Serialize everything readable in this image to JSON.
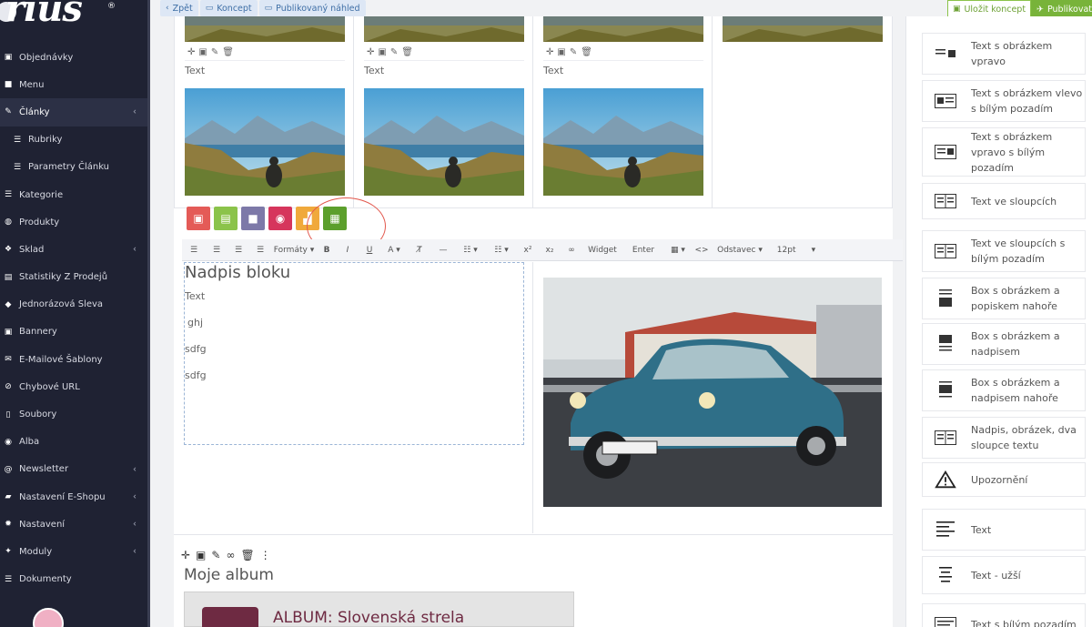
{
  "sidebar": {
    "logo_text": "rius",
    "items": [
      {
        "label": "Objednávky",
        "icon": "cart-icon",
        "chevron": false,
        "active": false,
        "sub": false
      },
      {
        "label": "Menu",
        "icon": "folder-icon",
        "chevron": false,
        "active": false,
        "sub": false
      },
      {
        "label": "Články",
        "icon": "pencil-icon",
        "chevron": true,
        "active": true,
        "sub": false
      },
      {
        "label": "Rubriky",
        "icon": "list-icon",
        "chevron": false,
        "active": false,
        "sub": true
      },
      {
        "label": "Parametry Článku",
        "icon": "sliders-icon",
        "chevron": false,
        "active": false,
        "sub": true
      },
      {
        "label": "Kategorie",
        "icon": "list-icon",
        "chevron": false,
        "active": false,
        "sub": false
      },
      {
        "label": "Produkty",
        "icon": "globe-icon",
        "chevron": false,
        "active": false,
        "sub": false
      },
      {
        "label": "Sklad",
        "icon": "boxes-icon",
        "chevron": true,
        "active": false,
        "sub": false
      },
      {
        "label": "Statistiky Z Prodejů",
        "icon": "chart-icon",
        "chevron": false,
        "active": false,
        "sub": false
      },
      {
        "label": "Jednorázová Sleva",
        "icon": "tag-icon",
        "chevron": false,
        "active": false,
        "sub": false
      },
      {
        "label": "Bannery",
        "icon": "image-icon",
        "chevron": false,
        "active": false,
        "sub": false
      },
      {
        "label": "E-Mailové Šablony",
        "icon": "envelope-icon",
        "chevron": false,
        "active": false,
        "sub": false
      },
      {
        "label": "Chybové URL",
        "icon": "unlink-icon",
        "chevron": false,
        "active": false,
        "sub": false
      },
      {
        "label": "Soubory",
        "icon": "file-icon",
        "chevron": false,
        "active": false,
        "sub": false
      },
      {
        "label": "Alba",
        "icon": "camera-icon",
        "chevron": false,
        "active": false,
        "sub": false
      },
      {
        "label": "Newsletter",
        "icon": "at-icon",
        "chevron": true,
        "active": false,
        "sub": false
      },
      {
        "label": "Nastavení E-Shopu",
        "icon": "truck-icon",
        "chevron": true,
        "active": false,
        "sub": false
      },
      {
        "label": "Nastavení",
        "icon": "gear-icon",
        "chevron": true,
        "active": false,
        "sub": false
      },
      {
        "label": "Moduly",
        "icon": "puzzle-icon",
        "chevron": true,
        "active": false,
        "sub": false
      },
      {
        "label": "Dokumenty",
        "icon": "list-icon",
        "chevron": false,
        "active": false,
        "sub": false
      }
    ]
  },
  "topbar": {
    "back": "Zpět",
    "draft": "Koncept",
    "preview": "Publikovaný náhled",
    "save_draft": "Uložit koncept",
    "publish": "Publikovat"
  },
  "gallery": {
    "caption": "Text"
  },
  "rte": {
    "formats": "Formáty",
    "widget": "Widget",
    "enter": "Enter",
    "paragraph": "Odstavec",
    "font_size": "12pt"
  },
  "text_block": {
    "heading": "Nadpis bloku",
    "lines": [
      "Text",
      "ghj",
      "sdfg",
      "sdfg"
    ]
  },
  "album": {
    "title": "Moje album",
    "label": "ALBUM: Slovenská strela"
  },
  "widgets": [
    {
      "label": "Text s obrázkem vpravo",
      "icon": "text-image-right-icon"
    },
    {
      "label": "Text s obrázkem vlevo s bílým pozadím",
      "icon": "text-image-left-white-icon"
    },
    {
      "label": "Text s obrázkem vpravo s bílým pozadím",
      "icon": "text-image-right-white-icon"
    },
    {
      "label": "Text ve sloupcích",
      "icon": "columns-icon"
    },
    {
      "label": "Text ve sloupcích s bílým pozadím",
      "icon": "columns-white-icon"
    },
    {
      "label": "Box s obrázkem a popiskem nahoře",
      "icon": "box-image-caption-top-icon"
    },
    {
      "label": "Box s obrázkem a nadpisem",
      "icon": "box-image-heading-icon"
    },
    {
      "label": "Box s obrázkem a nadpisem nahoře",
      "icon": "box-image-heading-top-icon"
    },
    {
      "label": "Nadpis, obrázek, dva sloupce textu",
      "icon": "heading-image-columns-icon"
    },
    {
      "label": "Upozornění",
      "icon": "warning-icon"
    },
    {
      "label": "Text",
      "icon": "text-lines-icon"
    },
    {
      "label": "Text - užší",
      "icon": "text-narrow-icon"
    },
    {
      "label": "Text s bílým pozadím",
      "icon": "text-white-icon"
    }
  ],
  "colors": {
    "sidebar_bg": "#1f2233",
    "accent_green": "#78b33a",
    "btn_red": "#e45b57",
    "btn_green": "#8bc34a",
    "btn_purple": "#7d79a8",
    "btn_pink": "#d6355c",
    "btn_orange": "#f0a93b",
    "btn_darkgreen": "#5c9f2c"
  }
}
